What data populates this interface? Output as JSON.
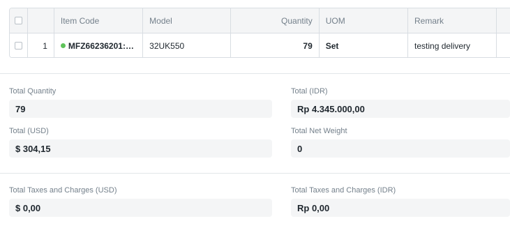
{
  "items_table": {
    "columns": {
      "item_code": "Item Code",
      "model": "Model",
      "quantity": "Quantity",
      "uom": "UOM",
      "remark": "Remark"
    },
    "rows": [
      {
        "index": "1",
        "item_code": "MFZ66236201: St...",
        "status_color": "#5fc35a",
        "model": "32UK550",
        "quantity": "79",
        "uom": "Set",
        "remark": "testing delivery"
      }
    ]
  },
  "totals": {
    "total_quantity": {
      "label": "Total Quantity",
      "value": "79"
    },
    "total_idr": {
      "label": "Total (IDR)",
      "value": "Rp 4.345.000,00"
    },
    "total_usd": {
      "label": "Total (USD)",
      "value": "$ 304,15"
    },
    "total_net_weight": {
      "label": "Total Net Weight",
      "value": "0"
    }
  },
  "taxes": {
    "usd": {
      "label": "Total Taxes and Charges (USD)",
      "value": "$ 0,00"
    },
    "idr": {
      "label": "Total Taxes and Charges (IDR)",
      "value": "Rp 0,00"
    }
  }
}
